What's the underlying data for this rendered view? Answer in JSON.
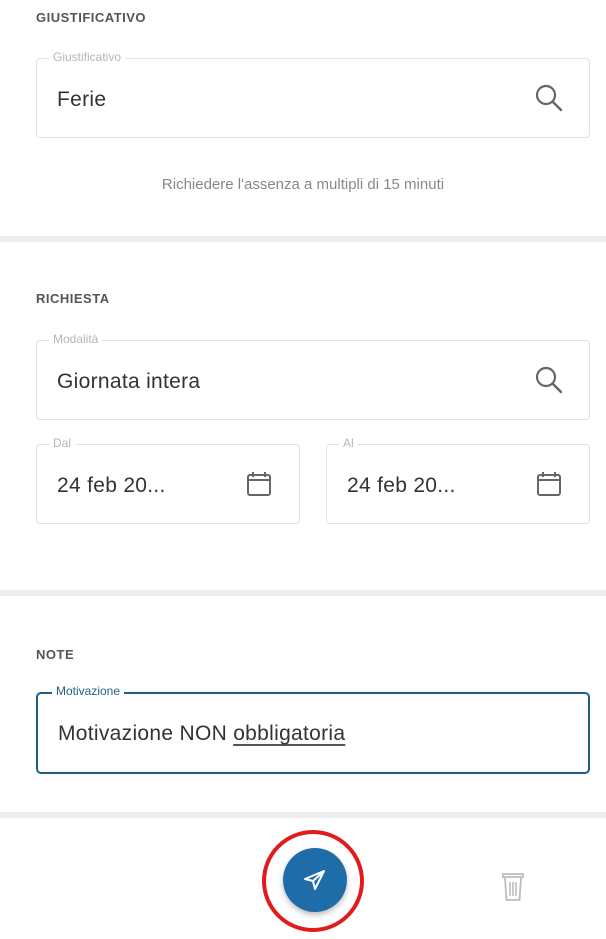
{
  "giustificativo": {
    "section_title": "GIUSTIFICATIVO",
    "field_label": "Giustificativo",
    "field_value": "Ferie",
    "icon": "search-icon",
    "hint": "Richiedere l'assenza a multipli di 15 minuti"
  },
  "richiesta": {
    "section_title": "RICHIESTA",
    "modalita_label": "Modalità",
    "modalita_value": "Giornata intera",
    "modalita_icon": "search-icon",
    "dal_label": "Dal",
    "dal_value": "24 feb 20...",
    "al_label": "Al",
    "al_value": "24 feb 20...",
    "date_icon": "calendar-icon"
  },
  "note": {
    "section_title": "NOTE",
    "field_label": "Motivazione",
    "field_value_part1": "Motivazione NON ",
    "field_value_part2": "obbligatoria"
  },
  "actions": {
    "send_icon": "send-icon",
    "delete_icon": "trash-icon"
  },
  "colors": {
    "accent": "#1f6da8",
    "focus_border": "#1e5f86",
    "highlight_ring": "#e11b1b",
    "divider": "#eceef0"
  }
}
